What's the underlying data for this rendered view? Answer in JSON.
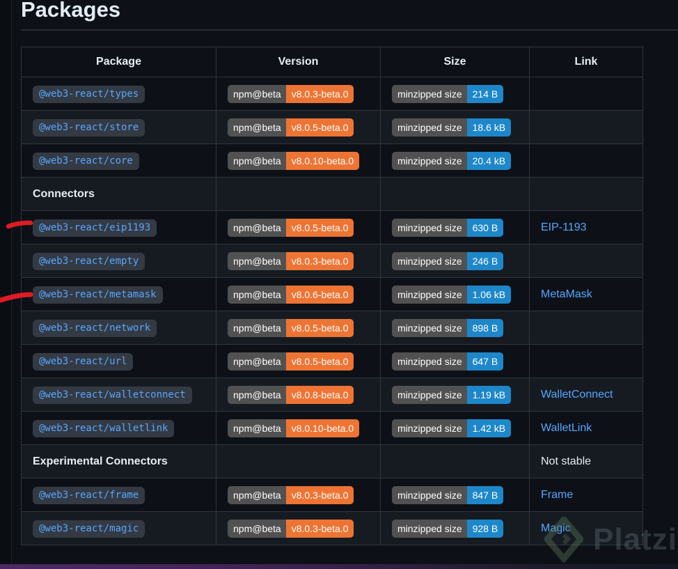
{
  "page": {
    "title": "Packages"
  },
  "table": {
    "headers": [
      "Package",
      "Version",
      "Size",
      "Link"
    ],
    "badge_labels": {
      "version": "npm@beta",
      "size": "minzipped size"
    },
    "rows": [
      {
        "kind": "package",
        "package": "@web3-react/types",
        "version": "v8.0.3-beta.0",
        "size": "214 B",
        "link": ""
      },
      {
        "kind": "package",
        "package": "@web3-react/store",
        "version": "v8.0.5-beta.0",
        "size": "18.6 kB",
        "link": ""
      },
      {
        "kind": "package",
        "package": "@web3-react/core",
        "version": "v8.0.10-beta.0",
        "size": "20.4 kB",
        "link": ""
      },
      {
        "kind": "section",
        "label": "Connectors",
        "note": ""
      },
      {
        "kind": "package",
        "package": "@web3-react/eip1193",
        "version": "v8.0.5-beta.0",
        "size": "630 B",
        "link": "EIP-1193"
      },
      {
        "kind": "package",
        "package": "@web3-react/empty",
        "version": "v8.0.3-beta.0",
        "size": "246 B",
        "link": ""
      },
      {
        "kind": "package",
        "package": "@web3-react/metamask",
        "version": "v8.0.6-beta.0",
        "size": "1.06 kB",
        "link": "MetaMask"
      },
      {
        "kind": "package",
        "package": "@web3-react/network",
        "version": "v8.0.5-beta.0",
        "size": "898 B",
        "link": ""
      },
      {
        "kind": "package",
        "package": "@web3-react/url",
        "version": "v8.0.5-beta.0",
        "size": "647 B",
        "link": ""
      },
      {
        "kind": "package",
        "package": "@web3-react/walletconnect",
        "version": "v8.0.8-beta.0",
        "size": "1.19 kB",
        "link": "WalletConnect"
      },
      {
        "kind": "package",
        "package": "@web3-react/walletlink",
        "version": "v8.0.10-beta.0",
        "size": "1.42 kB",
        "link": "WalletLink"
      },
      {
        "kind": "section",
        "label": "Experimental Connectors",
        "note": "Not stable"
      },
      {
        "kind": "package",
        "package": "@web3-react/frame",
        "version": "v8.0.3-beta.0",
        "size": "847 B",
        "link": "Frame"
      },
      {
        "kind": "package",
        "package": "@web3-react/magic",
        "version": "v8.0.3-beta.0",
        "size": "928 B",
        "link": "Magic"
      }
    ]
  },
  "watermark": {
    "brand": "Platzi"
  },
  "colors": {
    "background": "#0d1117",
    "row_alt": "#161b22",
    "border": "#30363d",
    "link_blue": "#58a6ff",
    "badge_gray": "#515151",
    "badge_orange": "#ee7434",
    "badge_blue": "#1e87c9",
    "annotation_red": "#e01b24"
  }
}
